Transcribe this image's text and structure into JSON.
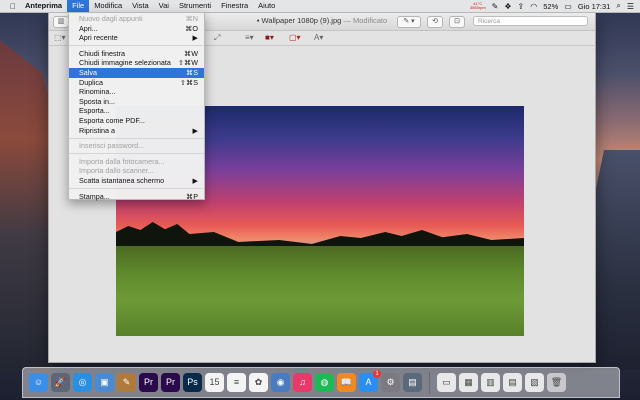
{
  "menubar": {
    "app": "Anteprima",
    "items": [
      "File",
      "Modifica",
      "Vista",
      "Vai",
      "Strumenti",
      "Finestra",
      "Aiuto"
    ],
    "temp_top": "41°C",
    "temp_bottom": "3565rpm",
    "battery": "52%",
    "clock": "Gio 17:31"
  },
  "window": {
    "title": "Wallpaper 1080p (9).jpg",
    "status": "— Modificato",
    "search_placeholder": "Ricerca"
  },
  "file_menu": {
    "items": [
      {
        "label": "Nuovo dagli appunti",
        "shortcut": "⌘N",
        "disabled": true
      },
      {
        "label": "Apri...",
        "shortcut": "⌘O"
      },
      {
        "label": "Apri recente",
        "shortcut": "▶"
      },
      {
        "sep": true
      },
      {
        "label": "Chiudi finestra",
        "shortcut": "⌘W"
      },
      {
        "label": "Chiudi immagine selezionata",
        "shortcut": "⇧⌘W"
      },
      {
        "label": "Salva",
        "shortcut": "⌘S",
        "selected": true
      },
      {
        "label": "Duplica",
        "shortcut": "⇧⌘S"
      },
      {
        "label": "Rinomina..."
      },
      {
        "label": "Sposta in..."
      },
      {
        "label": "Esporta..."
      },
      {
        "label": "Esporta come PDF..."
      },
      {
        "label": "Ripristina a",
        "shortcut": "▶"
      },
      {
        "sep": true
      },
      {
        "label": "Inserisci password...",
        "disabled": true
      },
      {
        "sep": true
      },
      {
        "label": "Importa dalla fotocamera...",
        "disabled": true
      },
      {
        "label": "Importa dallo scanner...",
        "disabled": true
      },
      {
        "label": "Scatta istantanea schermo",
        "shortcut": "▶"
      },
      {
        "sep": true
      },
      {
        "label": "Stampa...",
        "shortcut": "⌘P"
      }
    ]
  },
  "dock": {
    "apps": [
      {
        "name": "finder-icon",
        "glyph": "☺",
        "color": "#3a8ee6"
      },
      {
        "name": "launchpad-icon",
        "glyph": "🚀",
        "color": "#5d6676"
      },
      {
        "name": "safari-icon",
        "glyph": "◎",
        "color": "#2b8fe0"
      },
      {
        "name": "preview-icon",
        "glyph": "▣",
        "color": "#4a8ad0"
      },
      {
        "name": "notes-book-icon",
        "glyph": "✎",
        "color": "#b07a3c"
      },
      {
        "name": "premiere-icon",
        "glyph": "Pr",
        "color": "#2a0a4a"
      },
      {
        "name": "premiere-2-icon",
        "glyph": "Pr",
        "color": "#2a0a4a"
      },
      {
        "name": "photoshop-icon",
        "glyph": "Ps",
        "color": "#0a2a4a"
      },
      {
        "name": "calendar-icon",
        "glyph": "15",
        "color": "#f4f4f4"
      },
      {
        "name": "reminders-icon",
        "glyph": "≡",
        "color": "#f4f4f4"
      },
      {
        "name": "photos-icon",
        "glyph": "✿",
        "color": "#f4f4f4"
      },
      {
        "name": "photo-booth-icon",
        "glyph": "◉",
        "color": "#4a7ac0"
      },
      {
        "name": "itunes-icon",
        "glyph": "♫",
        "color": "#e83a6a"
      },
      {
        "name": "spotify-icon",
        "glyph": "◍",
        "color": "#1db954"
      },
      {
        "name": "ibooks-icon",
        "glyph": "📖",
        "color": "#f08a20"
      },
      {
        "name": "app-store-icon",
        "glyph": "A",
        "color": "#2a8ef0"
      },
      {
        "name": "system-prefs-icon",
        "glyph": "⚙",
        "color": "#7a7a80"
      },
      {
        "name": "image-capture-icon",
        "glyph": "▤",
        "color": "#5a6a7a"
      }
    ],
    "docs": [
      {
        "name": "document-icon",
        "glyph": "▭",
        "color": "#e8e8e8"
      },
      {
        "name": "document-icon",
        "glyph": "▦",
        "color": "#e8e8e8"
      },
      {
        "name": "document-icon",
        "glyph": "▥",
        "color": "#e8e8e8"
      },
      {
        "name": "document-icon",
        "glyph": "▤",
        "color": "#e8e8e8"
      },
      {
        "name": "document-icon",
        "glyph": "▧",
        "color": "#e8e8e8"
      },
      {
        "name": "trash-icon",
        "glyph": "🗑",
        "color": "#c8c8cc"
      }
    ],
    "app_store_badge": "1"
  }
}
